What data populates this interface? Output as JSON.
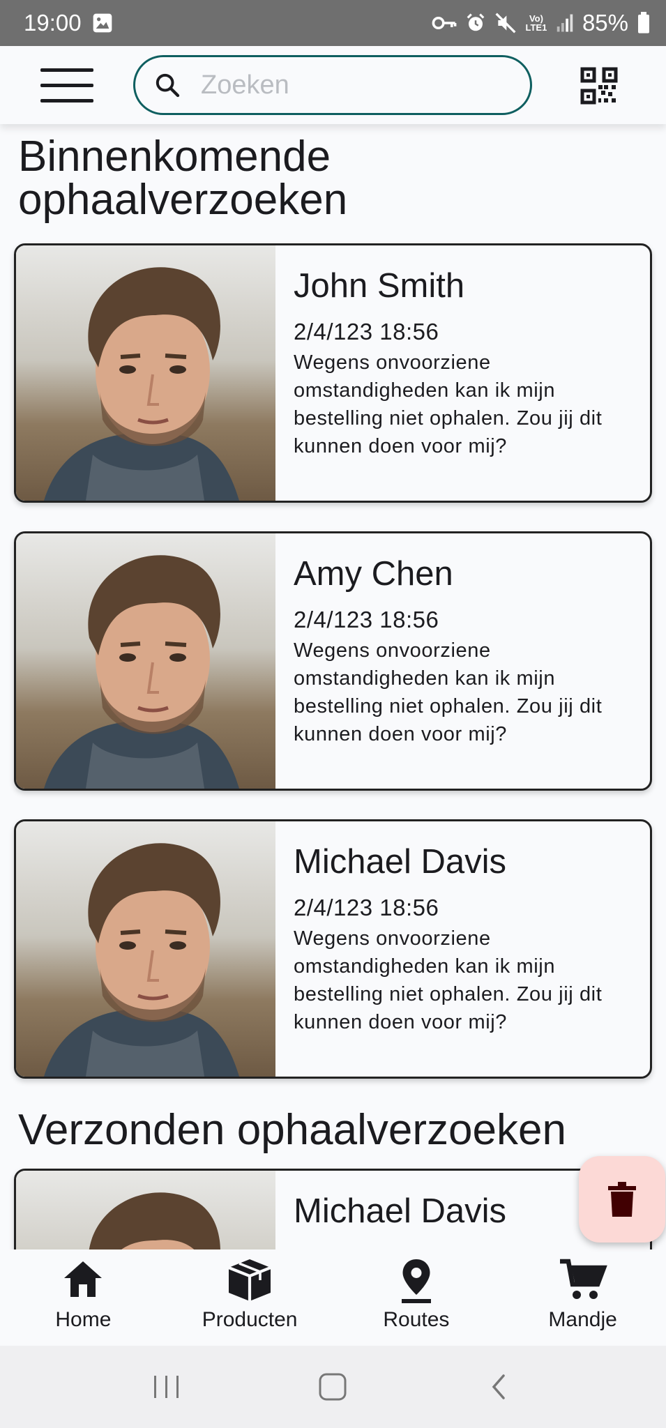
{
  "status_bar": {
    "time": "19:00",
    "battery": "85%",
    "network_label": "Vo) LTE1"
  },
  "top_bar": {
    "search_placeholder": "Zoeken",
    "accent_color": "#0f5f60"
  },
  "incoming": {
    "title_line1": "Binnenkomende",
    "title_line2": "ophaalverzoeken",
    "requests": [
      {
        "name": "John Smith",
        "date": "2/4/123 18:56",
        "message_lines": [
          "Wegens onvoorziene",
          "omstandigheden kan ik mijn",
          "bestelling niet ophalen. Zou jij dit",
          "kunnen doen voor mij?"
        ]
      },
      {
        "name": "Amy Chen",
        "date": "2/4/123 18:56",
        "message_lines": [
          "Wegens onvoorziene",
          "omstandigheden kan ik mijn",
          "bestelling niet ophalen. Zou jij dit",
          "kunnen doen voor mij?"
        ]
      },
      {
        "name": "Michael Davis",
        "date": "2/4/123 18:56",
        "message_lines": [
          "Wegens onvoorziene",
          "omstandigheden kan ik mijn",
          "bestelling niet ophalen. Zou jij dit",
          "kunnen doen voor mij?"
        ]
      }
    ]
  },
  "sent": {
    "title": "Verzonden ophaalverzoeken",
    "requests": [
      {
        "name": "Michael Davis"
      }
    ]
  },
  "fab": {
    "icon": "trash-icon",
    "color": "#fcd9d6"
  },
  "bottom_nav": {
    "items": [
      {
        "label": "Home",
        "icon": "home-icon"
      },
      {
        "label": "Producten",
        "icon": "box-icon"
      },
      {
        "label": "Routes",
        "icon": "location-pin-icon"
      },
      {
        "label": "Mandje",
        "icon": "cart-icon"
      }
    ]
  }
}
